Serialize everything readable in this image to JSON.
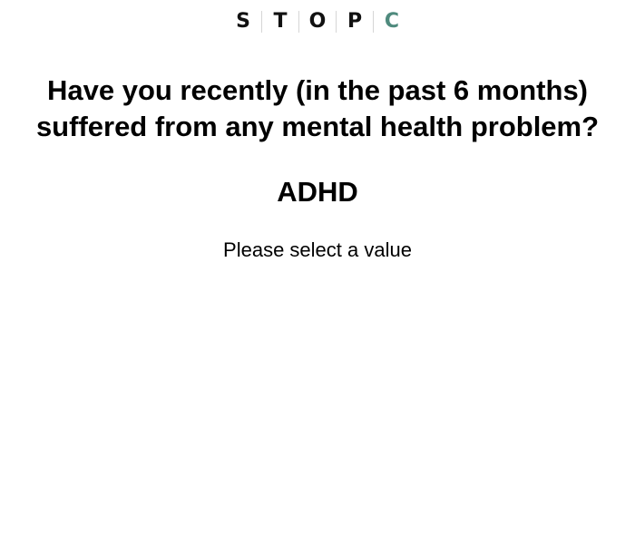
{
  "logo": {
    "letters": [
      "S",
      "T",
      "O",
      "P",
      "C"
    ],
    "accent_color": "#4f8a7d"
  },
  "question": {
    "line1": "Have you recently (in the past 6 months)",
    "line2": "suffered from any mental health problem?"
  },
  "item": {
    "label": "ADHD"
  },
  "prompt": {
    "text": "Please select a value"
  }
}
